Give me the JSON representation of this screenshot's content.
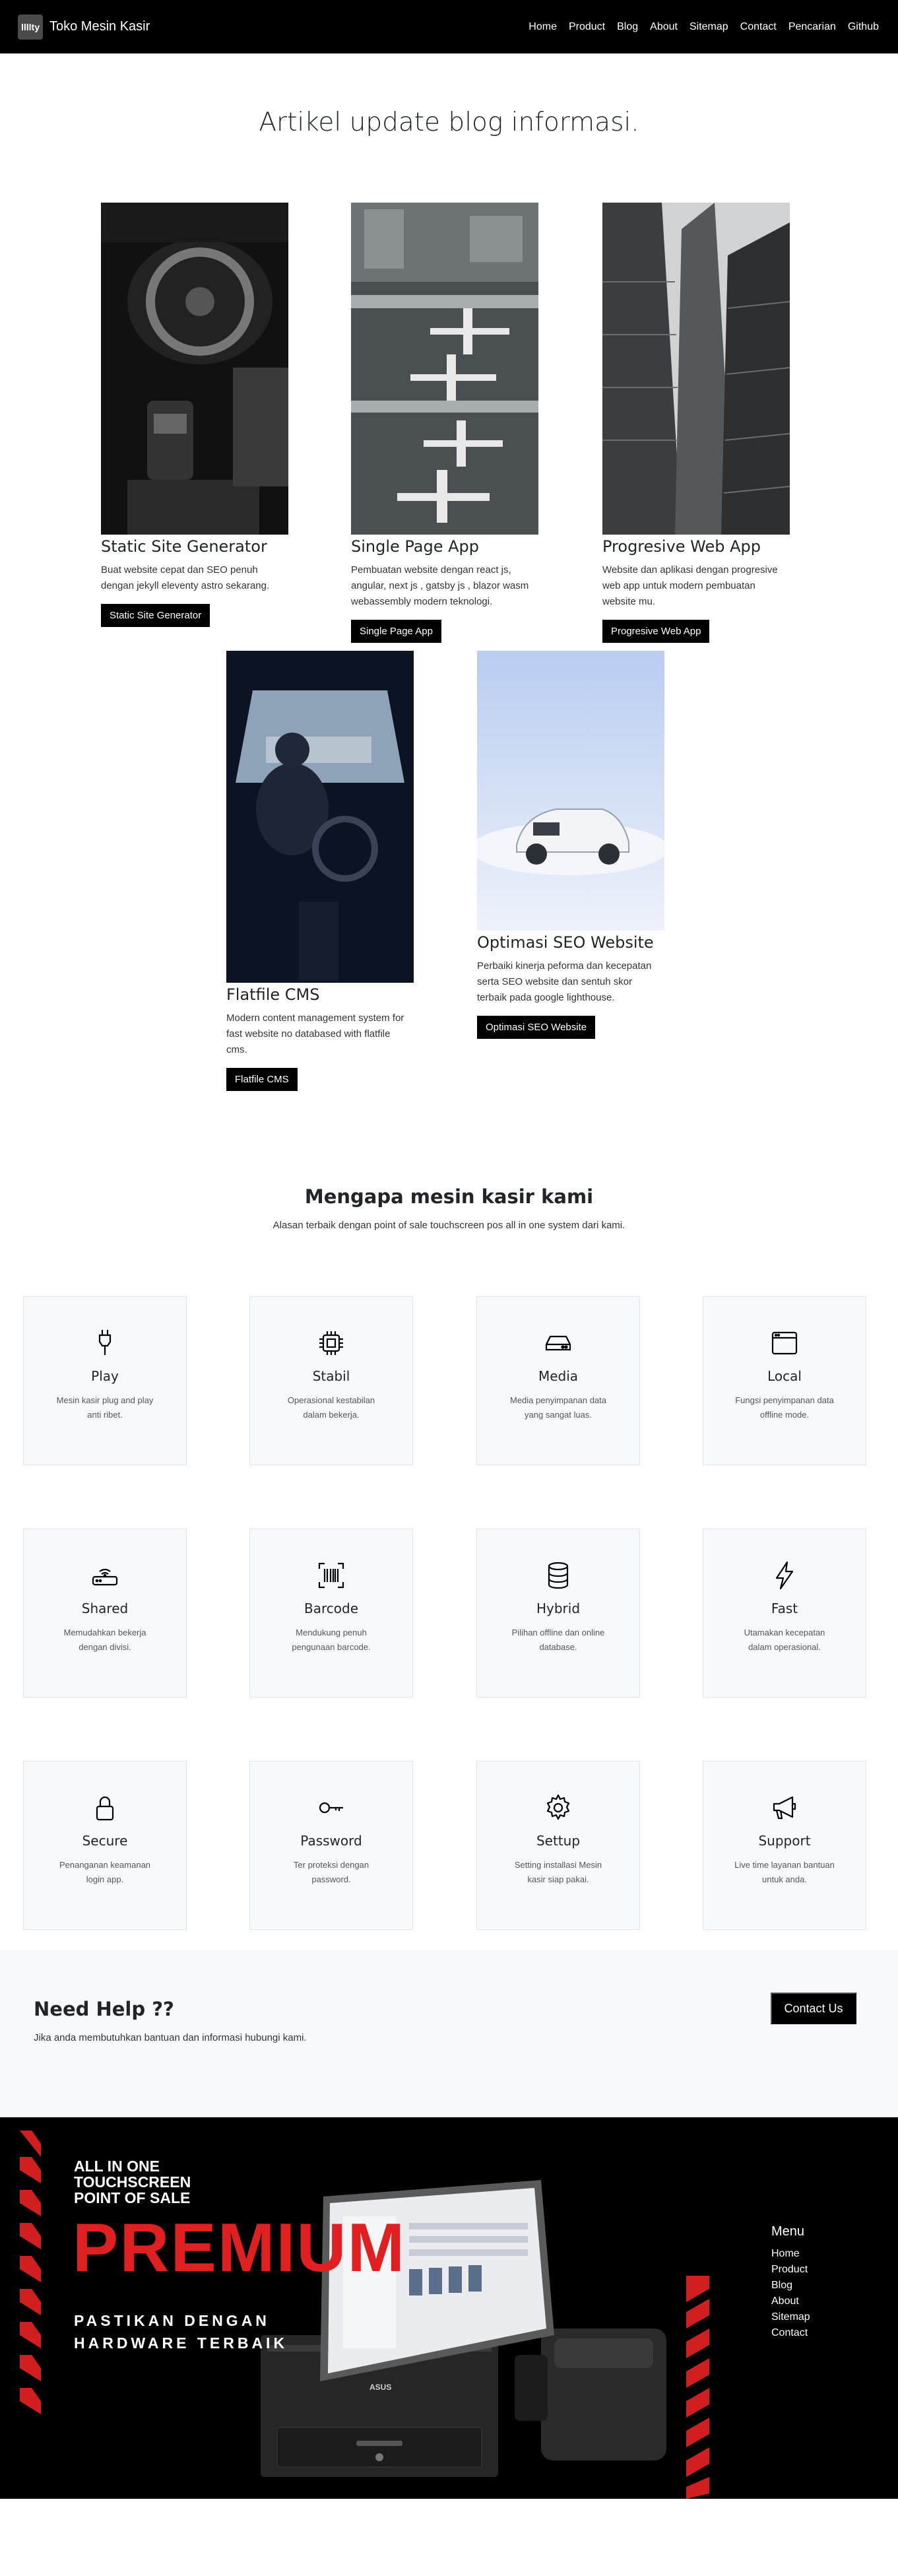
{
  "nav": {
    "brand_logo": "llllty",
    "brand": "Toko Mesin Kasir",
    "links": [
      "Home",
      "Product",
      "Blog",
      "About",
      "Sitemap",
      "Contact",
      "Pencarian",
      "Github"
    ]
  },
  "blog": {
    "title": "Artikel update blog informasi.",
    "cards": [
      {
        "title": "Static Site Generator",
        "text": "Buat website cepat dan SEO penuh dengan jekyll eleventy astro sekarang.",
        "button": "Static Site Generator"
      },
      {
        "title": "Single Page App",
        "text": "Pembuatan website dengan react js, angular, next js , gatsby js , blazor wasm webassembly modern teknologi.",
        "button": "Single Page App"
      },
      {
        "title": "Progresive Web App",
        "text": "Website dan aplikasi dengan progresive web app untuk modern pembuatan website mu.",
        "button": "Progresive Web App"
      },
      {
        "title": "Flatfile CMS",
        "text": "Modern content management system for fast website no databased with flatfile cms.",
        "button": "Flatfile CMS"
      },
      {
        "title": "Optimasi SEO Website",
        "text": "Perbaiki kinerja peforma dan kecepatan serta SEO website dan sentuh skor terbaik pada google lighthouse.",
        "button": "Optimasi SEO Website"
      }
    ]
  },
  "features": {
    "title": "Mengapa mesin kasir kami",
    "subtitle": "Alasan terbaik dengan point of sale touchscreen pos all in one system dari kami.",
    "items": [
      {
        "icon": "plug-icon",
        "name": "Play",
        "desc": "Mesin kasir plug and play anti ribet."
      },
      {
        "icon": "cpu-icon",
        "name": "Stabil",
        "desc": "Operasional kestabilan dalam bekerja."
      },
      {
        "icon": "hdd-icon",
        "name": "Media",
        "desc": "Media penyimpanan data yang sangat luas."
      },
      {
        "icon": "window-icon",
        "name": "Local",
        "desc": "Fungsi penyimpanan data offline mode."
      },
      {
        "icon": "router-icon",
        "name": "Shared",
        "desc": "Memudahkan bekerja dengan divisi."
      },
      {
        "icon": "barcode-icon",
        "name": "Barcode",
        "desc": "Mendukung penuh pengunaan barcode."
      },
      {
        "icon": "database-icon",
        "name": "Hybrid",
        "desc": "Pilihan offline dan online database."
      },
      {
        "icon": "lightning-icon",
        "name": "Fast",
        "desc": "Utamakan kecepatan dalam operasional."
      },
      {
        "icon": "lock-icon",
        "name": "Secure",
        "desc": "Penanganan keamanan login app."
      },
      {
        "icon": "key-icon",
        "name": "Password",
        "desc": "Ter proteksi dengan password."
      },
      {
        "icon": "gear-icon",
        "name": "Settup",
        "desc": "Setting installasi Mesin kasir siap pakai."
      },
      {
        "icon": "megaphone-icon",
        "name": "Support",
        "desc": "Live time layanan bantuan untuk anda."
      }
    ]
  },
  "help": {
    "title": "Need Help ??",
    "text": "Jika anda membutuhkan bantuan dan informasi hubungi kami.",
    "button": "Contact Us"
  },
  "footer": {
    "promo": {
      "line1": "ALL IN ONE",
      "line2": "TOUCHSCREEN",
      "line3": "POINT OF SALE",
      "headline": "PREMIUM",
      "tagline1": "PASTIKAN DENGAN",
      "tagline2": "HARDWARE TERBAIK",
      "device_brand": "ASUS"
    },
    "menu_title": "Menu",
    "menu": [
      "Home",
      "Product",
      "Blog",
      "About",
      "Sitemap",
      "Contact"
    ]
  },
  "colors": {
    "dark": "#000000",
    "light_bg": "#f8f9fa",
    "accent_red": "#e02020"
  }
}
